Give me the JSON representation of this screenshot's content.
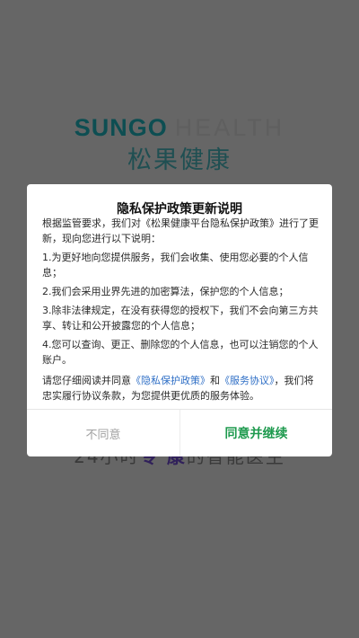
{
  "splash": {
    "logo_en_word1": "SUNGO",
    "logo_en_word2": "HEALTH",
    "logo_cn": "松果健康",
    "slogan_part1": "24小时",
    "slogan_accent1": "专",
    "slogan_part2": " ",
    "slogan_accent2": "康",
    "slogan_part3": "的智能医生"
  },
  "dialog": {
    "title": "隐私保护政策更新说明",
    "intro": "根据监管要求，我们对《松果健康平台隐私保护政策》进行了更新，现向您进行以下说明：",
    "items": [
      "1.为更好地向您提供服务，我们会收集、使用您必要的个人信息；",
      "2.我们会采用业界先进的加密算法，保护您的个人信息；",
      "3.除非法律规定，在没有获得您的授权下，我们不会向第三方共享、转让和公开披露您的个人信息；",
      "4.您可以查询、更正、删除您的个人信息，也可以注销您的个人账户。"
    ],
    "closing_prefix": "请您仔细阅读并同意",
    "privacy_link": "《隐私保护政策》",
    "and_text": "和",
    "service_link": "《服务协议》",
    "closing_suffix": "，我们将忠实履行协议条款，为您提供更优质的服务体验。",
    "decline_label": "不同意",
    "accept_label": "同意并继续"
  },
  "colors": {
    "overlay": "#666666",
    "accept": "#1e9a4e",
    "link": "#2f6fc6",
    "decline": "#a0a0a0"
  }
}
